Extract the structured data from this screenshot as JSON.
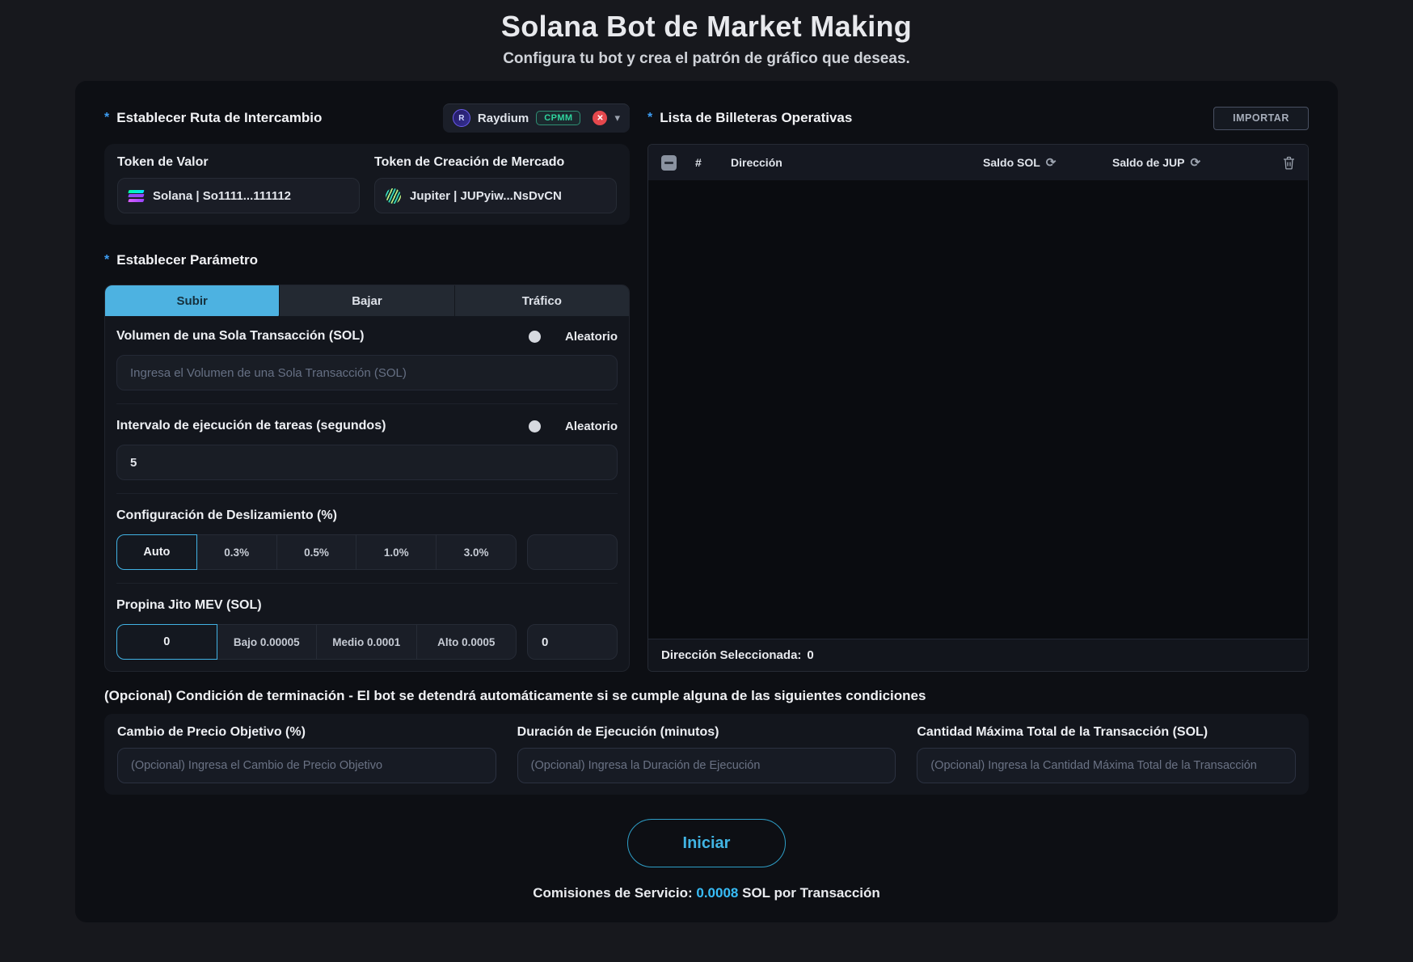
{
  "header": {
    "title": "Solana Bot de Market Making",
    "subtitle": "Configura tu bot y crea el patrón de gráfico que deseas."
  },
  "swap_route": {
    "required_mark": "*",
    "label": "Establecer Ruta de Intercambio",
    "dex": {
      "name": "Raydium",
      "badge": "CPMM",
      "icon_letter": "R"
    },
    "value_token": {
      "label": "Token de Valor",
      "value": "Solana | So1111...111112"
    },
    "market_token": {
      "label": "Token de Creación de Mercado",
      "value": "Jupiter | JUPyiw...NsDvCN"
    }
  },
  "parameters": {
    "required_mark": "*",
    "label": "Establecer Parámetro",
    "tabs": {
      "subir": "Subir",
      "bajar": "Bajar",
      "trafico": "Tráfico",
      "active": "Subir"
    },
    "volume": {
      "label": "Volumen de una Sola Transacción (SOL)",
      "random_label": "Aleatorio",
      "placeholder": "Ingresa el Volumen de una Sola Transacción (SOL)",
      "value": ""
    },
    "interval": {
      "label": "Intervalo de ejecución de tareas (segundos)",
      "random_label": "Aleatorio",
      "value": "5"
    },
    "slippage": {
      "label": "Configuración de Deslizamiento (%)",
      "options": [
        "Auto",
        "0.3%",
        "0.5%",
        "1.0%",
        "3.0%"
      ],
      "selected": "Auto",
      "custom_value": ""
    },
    "jito": {
      "label": "Propina Jito MEV (SOL)",
      "options": [
        "0",
        "Bajo 0.00005",
        "Medio 0.0001",
        "Alto 0.0005"
      ],
      "selected": "0",
      "custom_value": "0"
    }
  },
  "wallets": {
    "required_mark": "*",
    "label": "Lista de Billeteras Operativas",
    "import_label": "IMPORTAR",
    "columns": {
      "index": "#",
      "address": "Dirección",
      "sol_balance": "Saldo SOL",
      "jup_balance": "Saldo de JUP"
    },
    "rows": [],
    "selected_label": "Dirección Seleccionada:",
    "selected_count": "0"
  },
  "termination": {
    "heading": "(Opcional) Condición de terminación - El bot se detendrá automáticamente si se cumple alguna de las siguientes condiciones",
    "price_change": {
      "label": "Cambio de Precio Objetivo (%)",
      "placeholder": "(Opcional) Ingresa el Cambio de Precio Objetivo"
    },
    "duration": {
      "label": "Duración de Ejecución (minutos)",
      "placeholder": "(Opcional) Ingresa la Duración de Ejecución"
    },
    "max_amount": {
      "label": "Cantidad Máxima Total de la Transacción (SOL)",
      "placeholder": "(Opcional) Ingresa la Cantidad Máxima Total de la Transacción"
    }
  },
  "actions": {
    "start_label": "Iniciar",
    "fee_prefix": "Comisiones de Servicio:",
    "fee_amount": "0.0008",
    "fee_suffix": "SOL por Transacción"
  },
  "colors": {
    "accent_cyan": "#38bdf8",
    "tab_active": "#4db2e1",
    "badge_green": "#2fd49e",
    "danger_red": "#e5484d",
    "required_blue": "#3d9df3"
  }
}
